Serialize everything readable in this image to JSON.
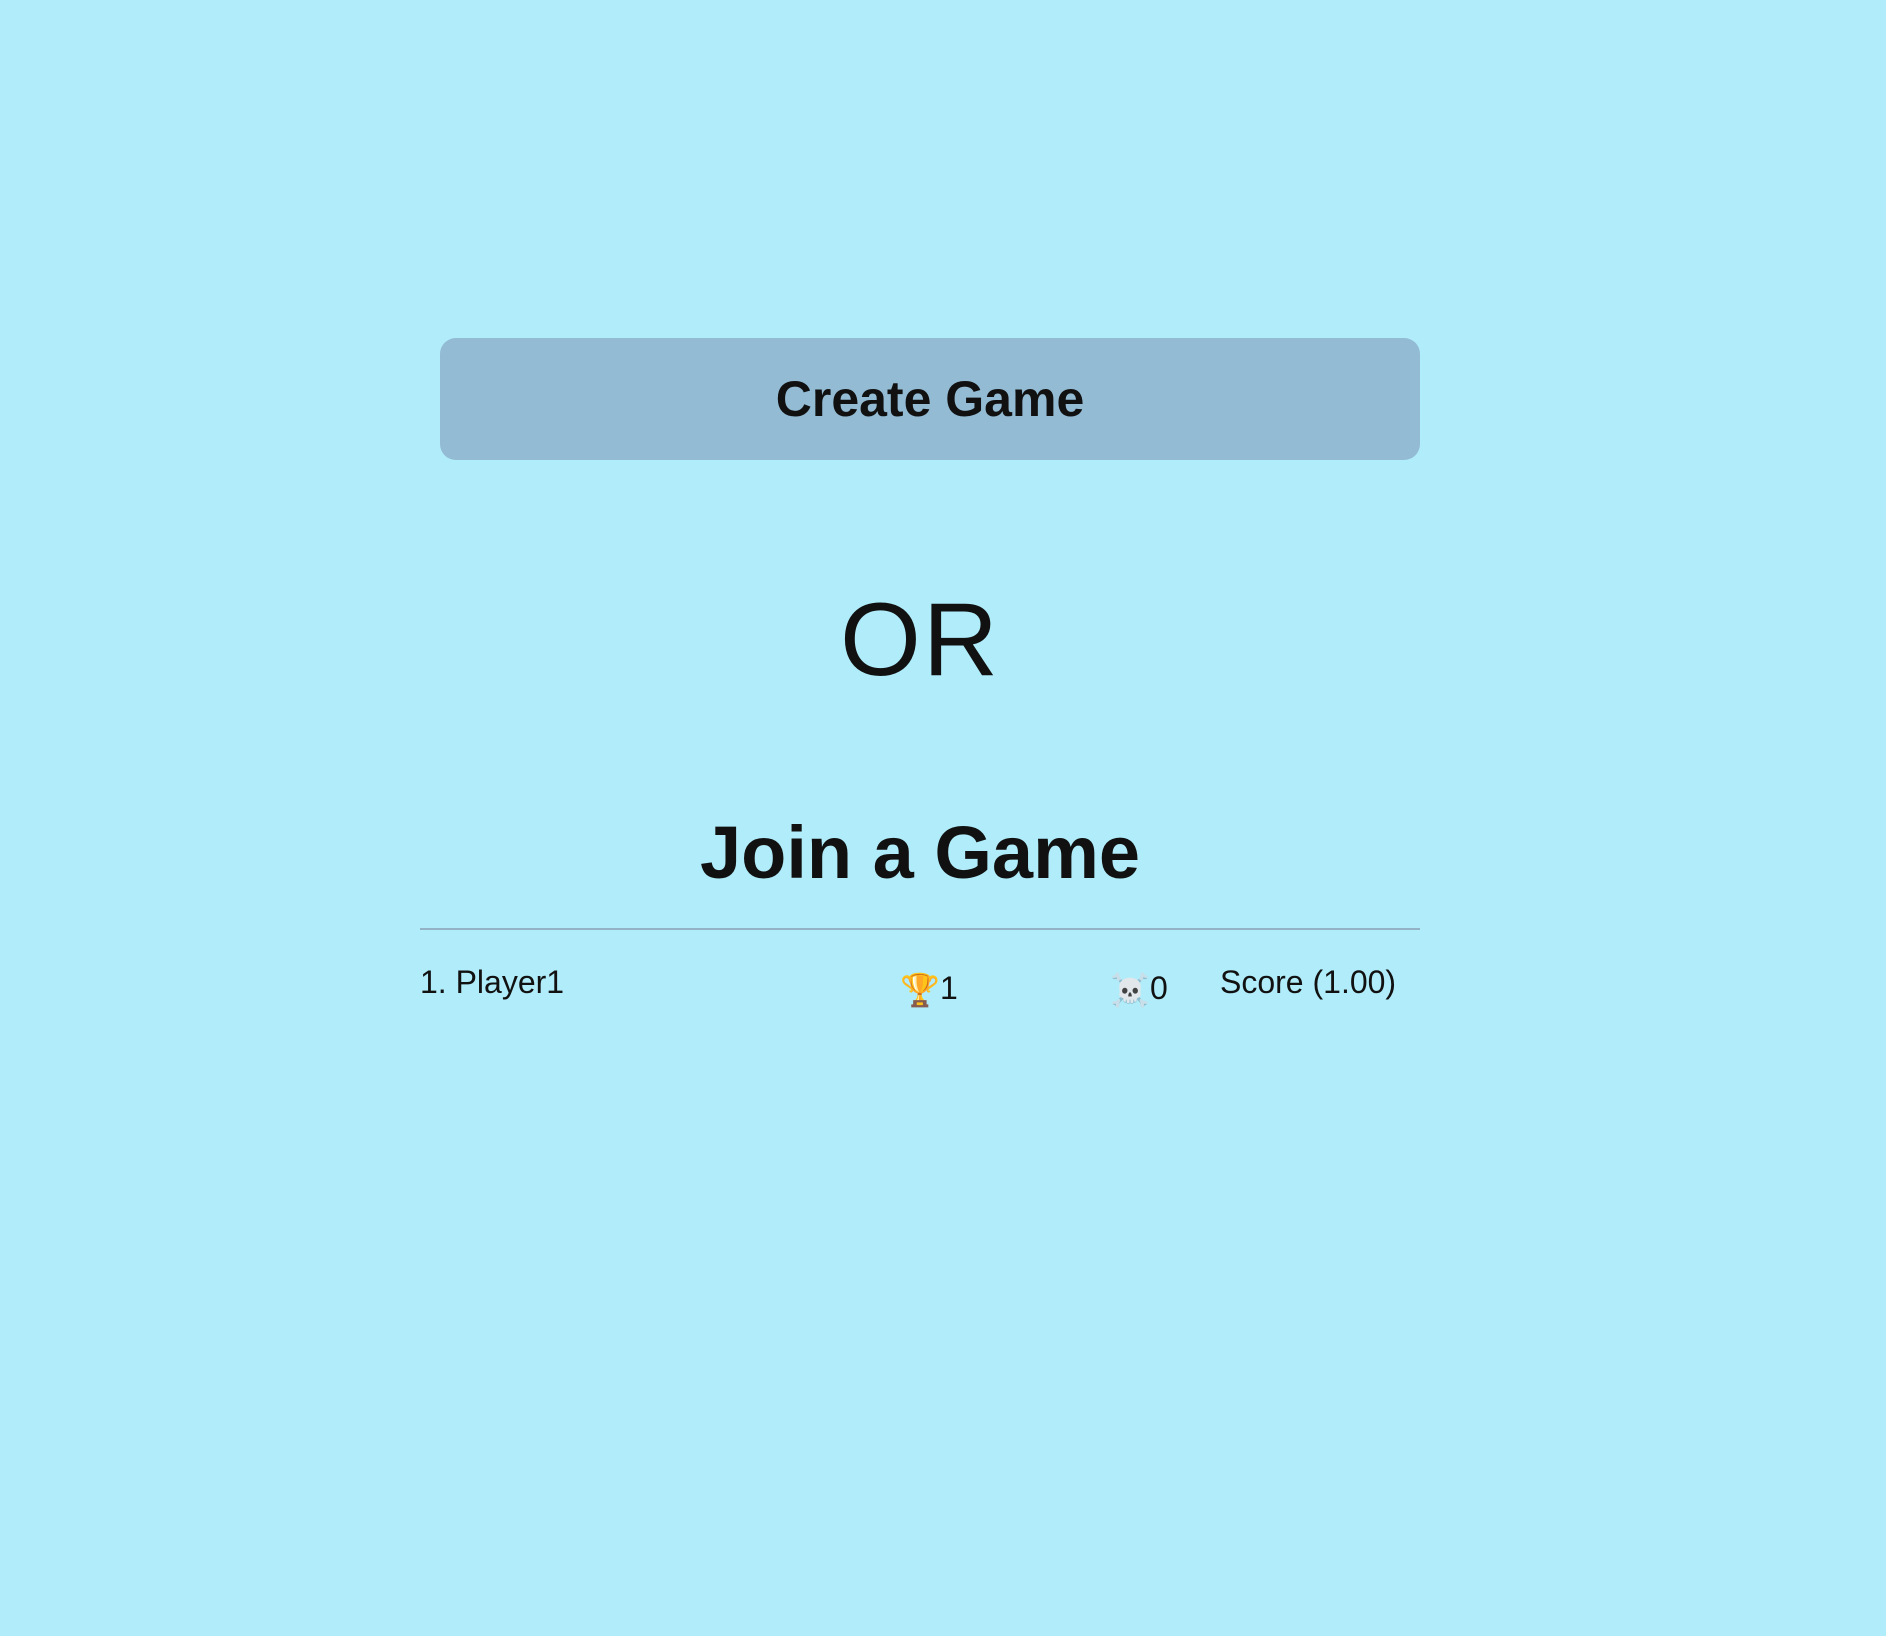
{
  "create_button": {
    "label": "Create Game"
  },
  "separator": {
    "text": "OR"
  },
  "join_section": {
    "title": "Join a Game",
    "games": [
      {
        "rank": "1.",
        "player": "Player1",
        "wins_icon": "🏆",
        "wins": "1",
        "losses_icon": "☠️",
        "losses": "0",
        "score": "Score (1.00)"
      }
    ]
  },
  "colors": {
    "background": "#b0ecf9",
    "button": "#93bbd4",
    "divider": "#93b2c6",
    "text": "#111111"
  },
  "icons": [
    "trophy-icon",
    "skull-icon"
  ]
}
